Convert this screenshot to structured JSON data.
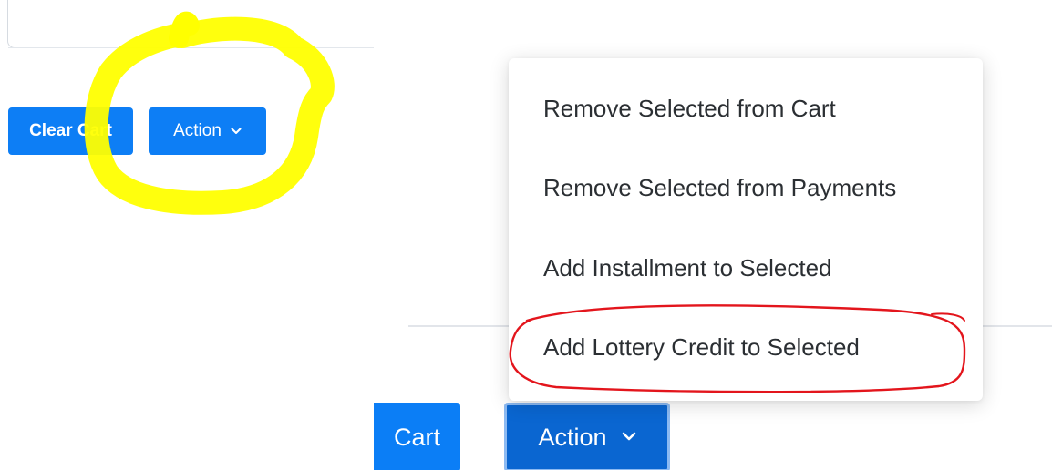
{
  "left_panel": {
    "clear_cart_label": "Clear Cart",
    "action_label": "Action",
    "chevron_icon": "chevron-down-icon"
  },
  "right_panel": {
    "cart_label": "Cart",
    "action_label": "Action",
    "chevron_icon": "chevron-down-icon",
    "dropdown": {
      "items": [
        {
          "label": "Remove Selected from Cart"
        },
        {
          "label": "Remove Selected from Payments"
        },
        {
          "label": "Add Installment to Selected"
        },
        {
          "label": "Add Lottery Credit to Selected"
        }
      ]
    }
  },
  "colors": {
    "primary_button": "#0d7ef5",
    "active_button": "#0a66d1",
    "yellow_highlight": "#ffff00",
    "red_circle": "#e3151c"
  }
}
